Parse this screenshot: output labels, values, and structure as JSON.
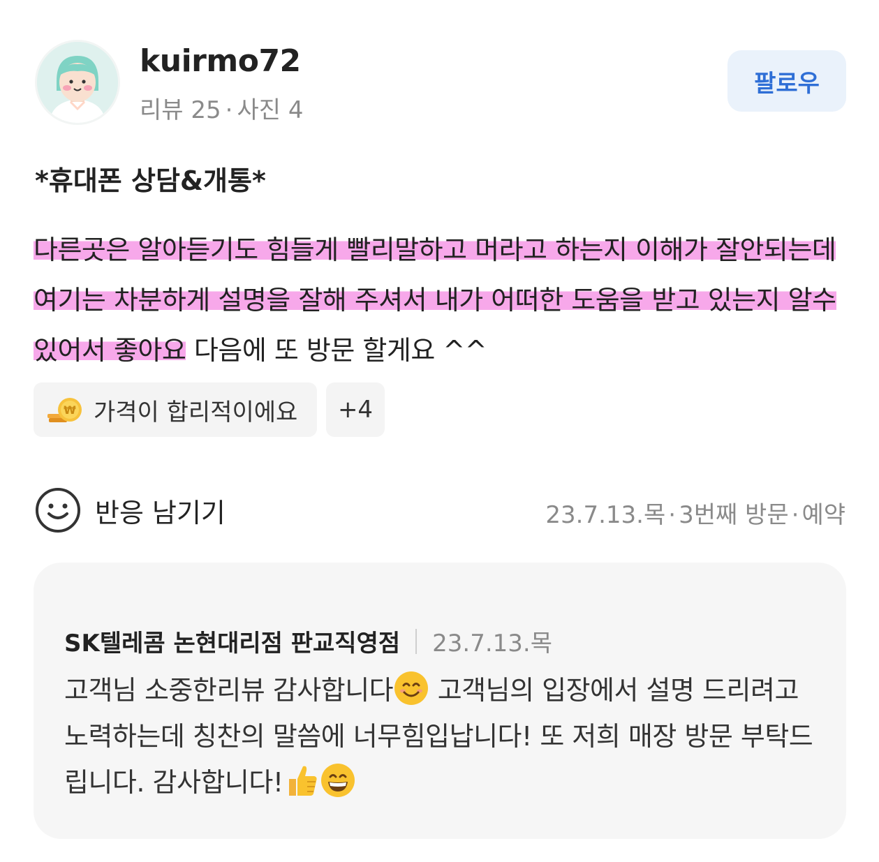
{
  "profile": {
    "username": "kuirmo72",
    "review_label": "리뷰 25",
    "photo_label": "사진 4",
    "separator": "·",
    "follow_label": "팔로우"
  },
  "review": {
    "title": "*휴대폰 상담&개통*",
    "highlighted_text": "다른곳은 알아듣기도 힘들게 빨리말하고 머라고 하는지 이해가 잘안되는데 여기는 차분하게 설명을 잘해 주셔서 내가 어떠한 도움을 받고 있는지 알수 있어서 좋아요",
    "plain_text": " 다음에 또 방문 할게요 ^^",
    "highlight_color": "#f7a8ea"
  },
  "tags": [
    {
      "icon": "coin-icon",
      "label": "가격이 합리적이에요"
    },
    {
      "label": "+4"
    }
  ],
  "reaction": {
    "icon": "smile-icon",
    "label": "반응 남기기"
  },
  "meta": {
    "date": "23.7.13.목",
    "visit": "3번째 방문",
    "type": "예약",
    "separator": "·"
  },
  "reply": {
    "store": "SK텔레콤 논현대리점 판교직영점",
    "date": "23.7.13.목",
    "text_1": "고객님 소중한리뷰 감사합니다",
    "emoji_1": "smiling-face-emoji",
    "text_2": " 고객님의 입장에서 설명 드리려고 노력하는데 칭찬의 말씀에 너무힘입납니다! 또 저희 매장 방문 부탁드립니다. 감사합니다!",
    "emoji_2": "thumbs-up-emoji",
    "emoji_3": "grinning-face-emoji"
  },
  "colors": {
    "follow_bg": "#eaf2fb",
    "follow_text": "#2f6fd6",
    "reply_bg": "#f6f6f6"
  }
}
